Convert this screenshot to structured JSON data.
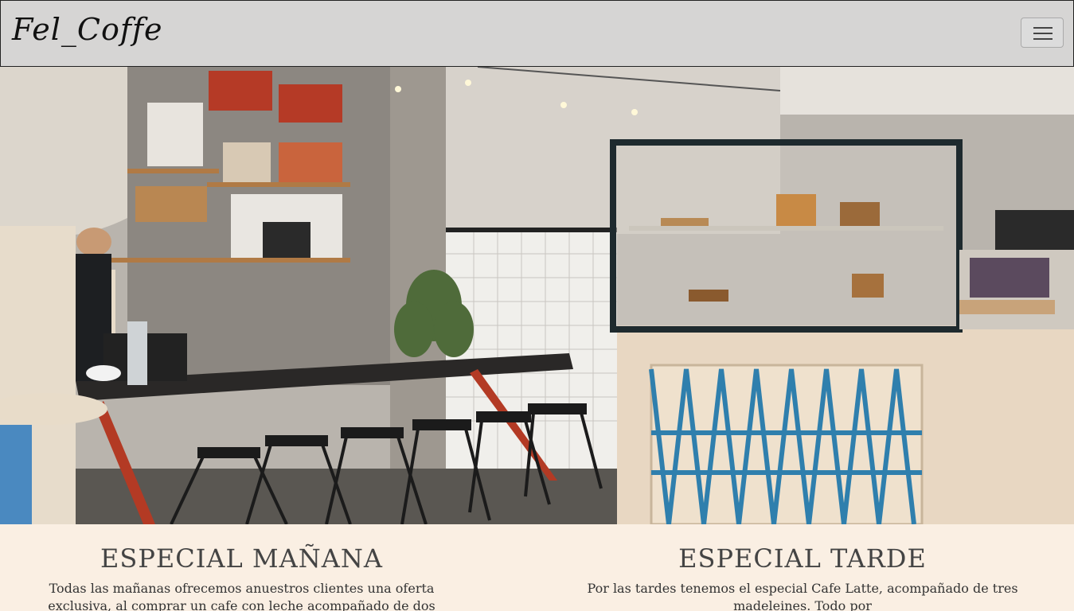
{
  "navbar": {
    "brand": "Fel_Coffe",
    "toggle_icon": "hamburger-menu-icon"
  },
  "hero": {
    "image": "cafe-interior-photo"
  },
  "specials": {
    "morning": {
      "title": "ESPECIAL MAÑANA",
      "text": "Todas las mañanas ofrecemos anuestros clientes una oferta exclusiva, al comprar un cafe con leche acompañado de dos medialunas a solo"
    },
    "afternoon": {
      "title": "ESPECIAL TARDE",
      "text": "Por las tardes tenemos el especial Cafe Latte, acompañado de tres madeleines. Todo por"
    }
  }
}
